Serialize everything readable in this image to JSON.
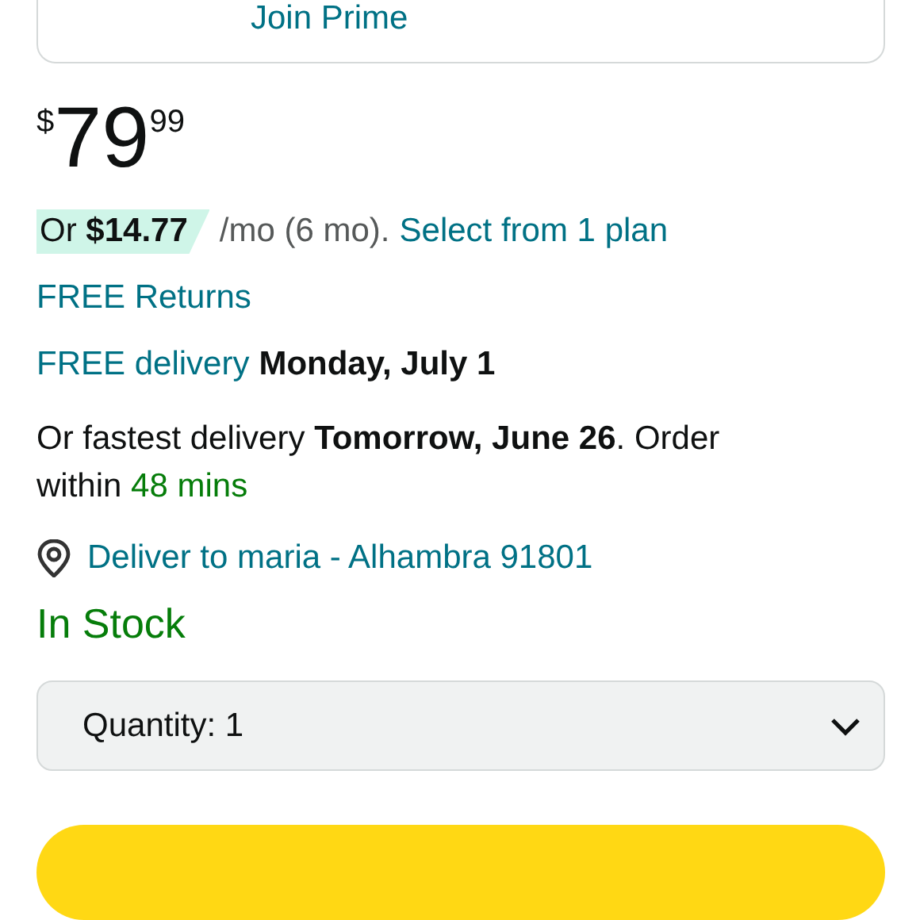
{
  "prime_card": {
    "link": "Join Prime"
  },
  "price": {
    "currency": "$",
    "whole": "79",
    "fraction": "99"
  },
  "installment": {
    "offer": "Or **$14.77**",
    "terms": "/mo (6 mo).",
    "link": "Select from 1 plan"
  },
  "returns": {
    "link": "FREE Returns"
  },
  "delivery": {
    "link": "FREE delivery",
    "date": "Monday, July 1"
  },
  "fastest": {
    "parts": [
      {
        "kind": "plain",
        "text": "Or fastest delivery"
      },
      {
        "kind": "bold",
        "text": "Tomorrow, June 26"
      },
      {
        "kind": "plain",
        "text": ". Order within"
      },
      {
        "kind": "green",
        "text": "48 mins"
      }
    ]
  },
  "deliver_to": {
    "link": "Deliver to maria - Alhambra 91801"
  },
  "stock": {
    "status": "In Stock"
  },
  "quantity": {
    "label": "Quantity:",
    "value": "1"
  },
  "primary_button": {
    "kind": "button"
  }
}
